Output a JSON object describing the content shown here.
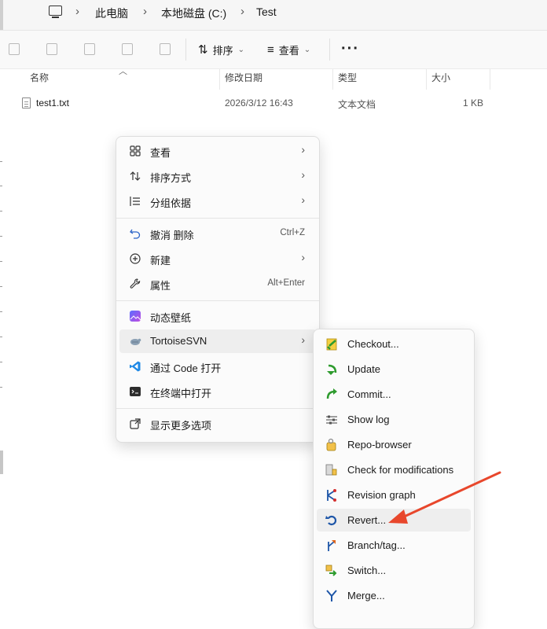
{
  "breadcrumb": {
    "items": [
      "此电脑",
      "本地磁盘 (C:)",
      "Test"
    ]
  },
  "toolbar": {
    "sort_label": "排序",
    "view_label": "查看",
    "more_label": "···"
  },
  "columns": {
    "name": "名称",
    "modified": "修改日期",
    "type": "类型",
    "size": "大小"
  },
  "files": [
    {
      "name": "test1.txt",
      "modified": "2026/3/12 16:43",
      "type": "文本文档",
      "size": "1 KB"
    }
  ],
  "context_menu": {
    "view": "查看",
    "sort_by": "排序方式",
    "group_by": "分组依据",
    "undo": "撤消 删除",
    "undo_shortcut": "Ctrl+Z",
    "new": "新建",
    "properties": "属性",
    "properties_shortcut": "Alt+Enter",
    "live_wallpaper": "动态壁纸",
    "tortoisesvn": "TortoiseSVN",
    "open_with_code": "通过 Code 打开",
    "open_in_terminal": "在终端中打开",
    "show_more_options": "显示更多选项"
  },
  "svn_menu": {
    "items": [
      "Checkout...",
      "Update",
      "Commit...",
      "Show log",
      "Repo-browser",
      "Check for modifications",
      "Revision graph",
      "Revert...",
      "Branch/tag...",
      "Switch...",
      "Merge..."
    ]
  },
  "colors": {
    "annotation_arrow": "#e8472c",
    "vscode_blue": "#1e88e5",
    "svn_green": "#4caf50"
  }
}
